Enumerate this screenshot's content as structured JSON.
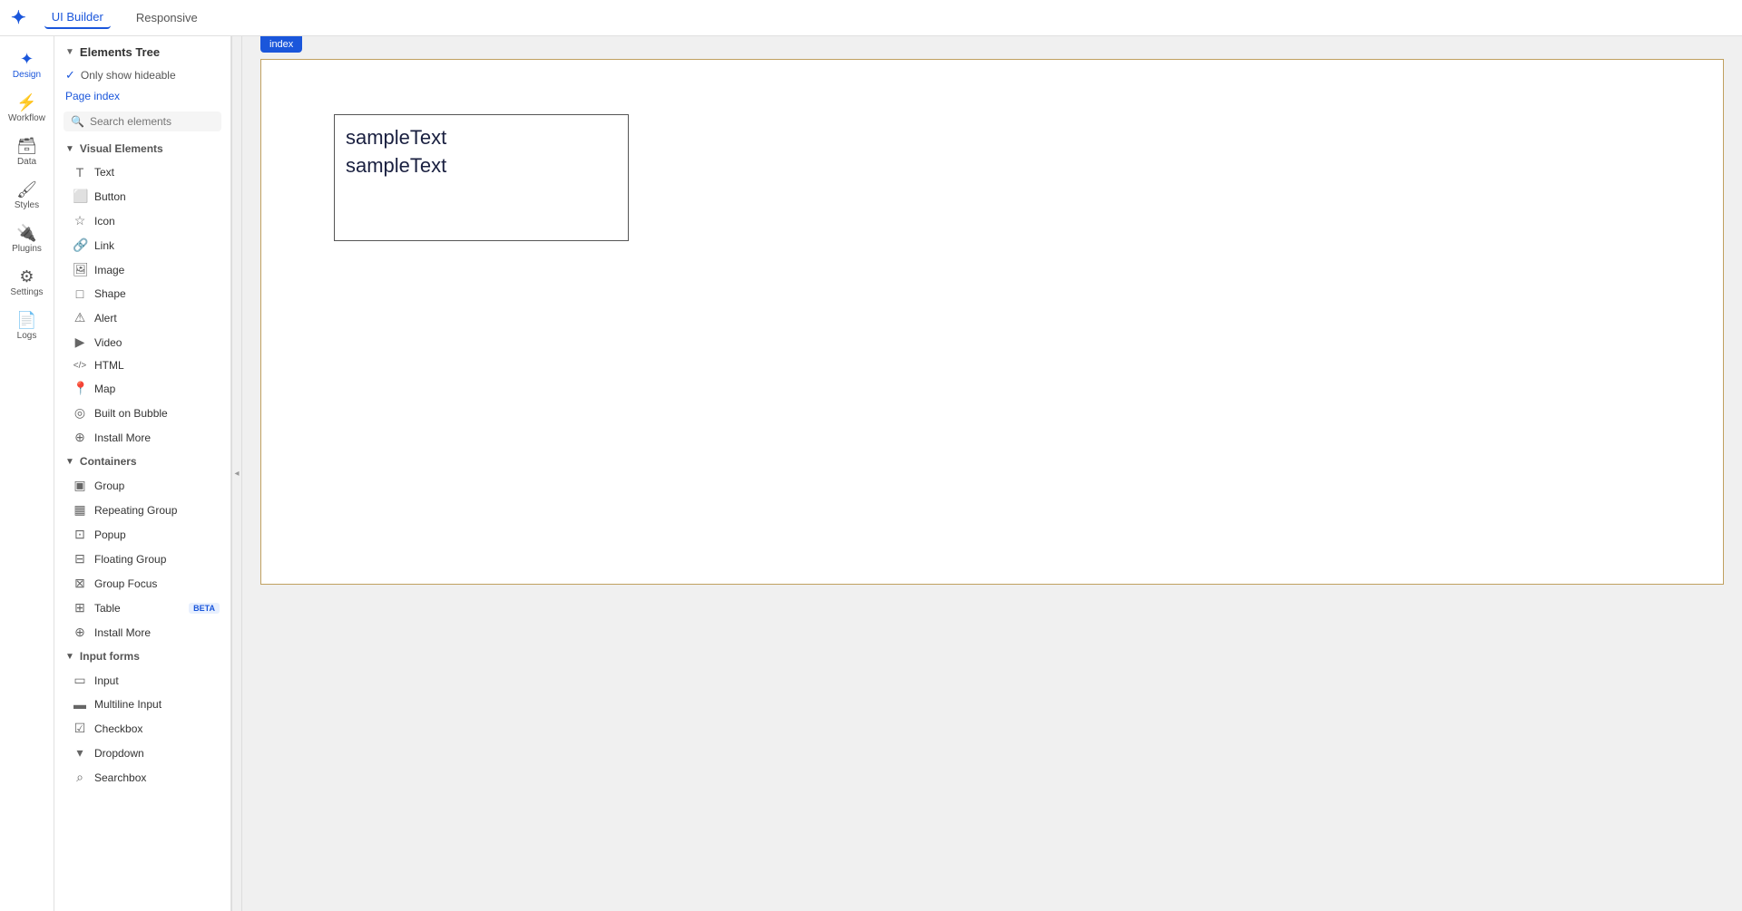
{
  "topbar": {
    "tab_ui_builder": "UI Builder",
    "tab_responsive": "Responsive"
  },
  "vertical_nav": {
    "items": [
      {
        "id": "design",
        "icon": "✦",
        "label": "Design",
        "active": true
      },
      {
        "id": "workflow",
        "icon": "⚡",
        "label": "Workflow",
        "active": false
      },
      {
        "id": "data",
        "icon": "🗄",
        "label": "Data",
        "active": false
      },
      {
        "id": "styles",
        "icon": "🖌",
        "label": "Styles",
        "active": false
      },
      {
        "id": "plugins",
        "icon": "🔌",
        "label": "Plugins",
        "active": false
      },
      {
        "id": "settings",
        "icon": "⚙",
        "label": "Settings",
        "active": false
      },
      {
        "id": "logs",
        "icon": "📄",
        "label": "Logs",
        "active": false
      }
    ]
  },
  "elements_panel": {
    "header": "Elements Tree",
    "show_hideable_label": "Only show hideable",
    "page_index_label": "Page index",
    "search_placeholder": "Search elements",
    "visual_elements_header": "Visual Elements",
    "containers_header": "Containers",
    "input_forms_header": "Input forms",
    "visual_elements": [
      {
        "id": "text",
        "icon": "T",
        "label": "Text"
      },
      {
        "id": "button",
        "icon": "⬜",
        "label": "Button"
      },
      {
        "id": "icon",
        "icon": "☆",
        "label": "Icon"
      },
      {
        "id": "link",
        "icon": "🔗",
        "label": "Link"
      },
      {
        "id": "image",
        "icon": "🖼",
        "label": "Image"
      },
      {
        "id": "shape",
        "icon": "□",
        "label": "Shape"
      },
      {
        "id": "alert",
        "icon": "⚠",
        "label": "Alert"
      },
      {
        "id": "video",
        "icon": "▶",
        "label": "Video"
      },
      {
        "id": "html",
        "icon": "</>",
        "label": "HTML"
      },
      {
        "id": "map",
        "icon": "📍",
        "label": "Map"
      },
      {
        "id": "built-on-bubble",
        "icon": "◎",
        "label": "Built on Bubble"
      },
      {
        "id": "install-more-visual",
        "icon": "⊕",
        "label": "Install More"
      }
    ],
    "containers": [
      {
        "id": "group",
        "icon": "▣",
        "label": "Group"
      },
      {
        "id": "repeating-group",
        "icon": "▦",
        "label": "Repeating Group"
      },
      {
        "id": "popup",
        "icon": "⊡",
        "label": "Popup"
      },
      {
        "id": "floating-group",
        "icon": "⊟",
        "label": "Floating Group"
      },
      {
        "id": "group-focus",
        "icon": "⊠",
        "label": "Group Focus"
      },
      {
        "id": "table",
        "icon": "⊞",
        "label": "Table",
        "badge": "BETA"
      },
      {
        "id": "install-more-containers",
        "icon": "⊕",
        "label": "Install More"
      }
    ],
    "input_forms": [
      {
        "id": "input",
        "icon": "▭",
        "label": "Input"
      },
      {
        "id": "multiline-input",
        "icon": "▬",
        "label": "Multiline Input"
      },
      {
        "id": "checkbox",
        "icon": "☑",
        "label": "Checkbox"
      },
      {
        "id": "dropdown",
        "icon": "▾",
        "label": "Dropdown"
      },
      {
        "id": "searchbox",
        "icon": "⌕",
        "label": "Searchbox"
      }
    ]
  },
  "canvas": {
    "tab_label": "index",
    "sample_text_1": "sampleText",
    "sample_text_2": "sampleText"
  }
}
